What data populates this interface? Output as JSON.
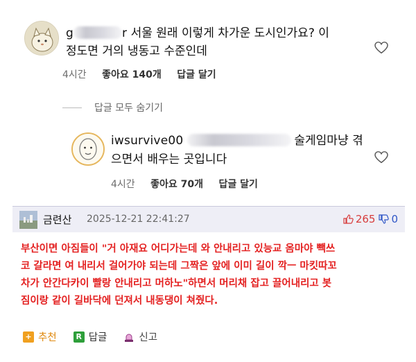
{
  "comments": [
    {
      "username_prefix": "g",
      "username_suffix": "r",
      "text_line1": "서울 원래 이렇게 차가운 도시인가요? 이",
      "text_line2": "정도면 거의 냉동고 수준인데",
      "time": "4시간",
      "likes": "좋아요 140개",
      "reply": "답글 달기"
    }
  ],
  "hide_replies": "답글 모두 숨기기",
  "reply": {
    "username": "iwsurvive00",
    "text_line1_tail": "술게임마냥 겪",
    "text_line2": "으면서 배우는 곳입니다",
    "time": "4시간",
    "likes": "좋아요 70개",
    "reply": "답글 달기"
  },
  "dc_comment": {
    "author": "금련산",
    "datetime": "2025-12-21 22:41:27",
    "upvotes": "265",
    "downvotes": "0",
    "body": [
      "부산이면 아짐들이 \"거 아재요 어디가는데 와 안내리고 있능교 옴마야 빽쓰",
      "코 갈라면 여 내리서 걸어가야 되는데 그짝은 앞에 이미 길이 깍ㅡ 마킷따꼬",
      "차가 안간다카이 빨랑 안내리고 머하노\"하면서 머리채 잡고 끌어내리고 봇",
      "짐이랑 같이 길바닥에 던져서 내동댕이 쳐줬다."
    ],
    "actions": {
      "recommend": "추천",
      "reply": "답글",
      "report": "신고"
    }
  },
  "colors": {
    "body_text_red": "#e42121",
    "header_bg": "#eeeef6",
    "upvote": "#d73c3c",
    "downvote": "#2f56c7"
  }
}
